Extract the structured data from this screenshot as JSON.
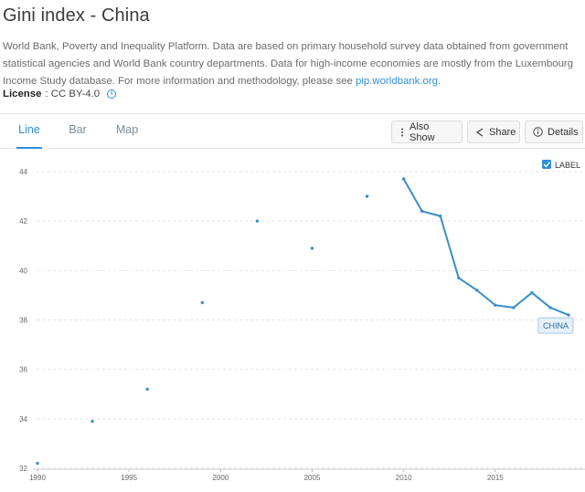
{
  "header": {
    "title": "Gini index - China",
    "description": "World Bank, Poverty and Inequality Platform. Data are based on primary household survey data obtained from government statistical agencies and World Bank country departments. Data for high-income economies are mostly from the Luxembourg Income Study database. For more information and methodology, please see ",
    "link_text": "pip.worldbank.org",
    "description_end": ".",
    "license_label": "License",
    "license_value": ": CC BY-4.0"
  },
  "tabs": [
    {
      "label": "Line",
      "active": true
    },
    {
      "label": "Bar",
      "active": false
    },
    {
      "label": "Map",
      "active": false
    }
  ],
  "toolbar": {
    "also_show": "Also Show",
    "share": "Share",
    "details": "Details"
  },
  "legend": {
    "checkbox_checked": true,
    "checkbox_label": "LABEL"
  },
  "colors": {
    "accent": "#2f8fd8",
    "series": "#3a8fc8",
    "grid": "#e3e3e3"
  },
  "chart_data": {
    "type": "line",
    "title": "Gini index - China",
    "xlabel": "",
    "ylabel": "",
    "xlim": [
      1990,
      2019.5
    ],
    "ylim": [
      32,
      44.5
    ],
    "x_ticks": [
      1990,
      1995,
      2000,
      2005,
      2010,
      2015
    ],
    "y_ticks": [
      32,
      34,
      36,
      38,
      40,
      42,
      44
    ],
    "grid": true,
    "series": [
      {
        "name": "CHINA",
        "points": [
          [
            1990,
            32.2
          ],
          [
            1993,
            33.9
          ],
          [
            1996,
            35.2
          ],
          [
            1999,
            38.7
          ],
          [
            2002,
            42.0
          ],
          [
            2005,
            40.9
          ],
          [
            2008,
            43.0
          ],
          [
            2010,
            43.7
          ],
          [
            2011,
            42.4
          ],
          [
            2012,
            42.2
          ],
          [
            2013,
            39.7
          ],
          [
            2014,
            39.2
          ],
          [
            2015,
            38.6
          ],
          [
            2016,
            38.5
          ],
          [
            2017,
            39.1
          ],
          [
            2018,
            38.5
          ],
          [
            2019,
            38.2
          ]
        ]
      }
    ]
  }
}
